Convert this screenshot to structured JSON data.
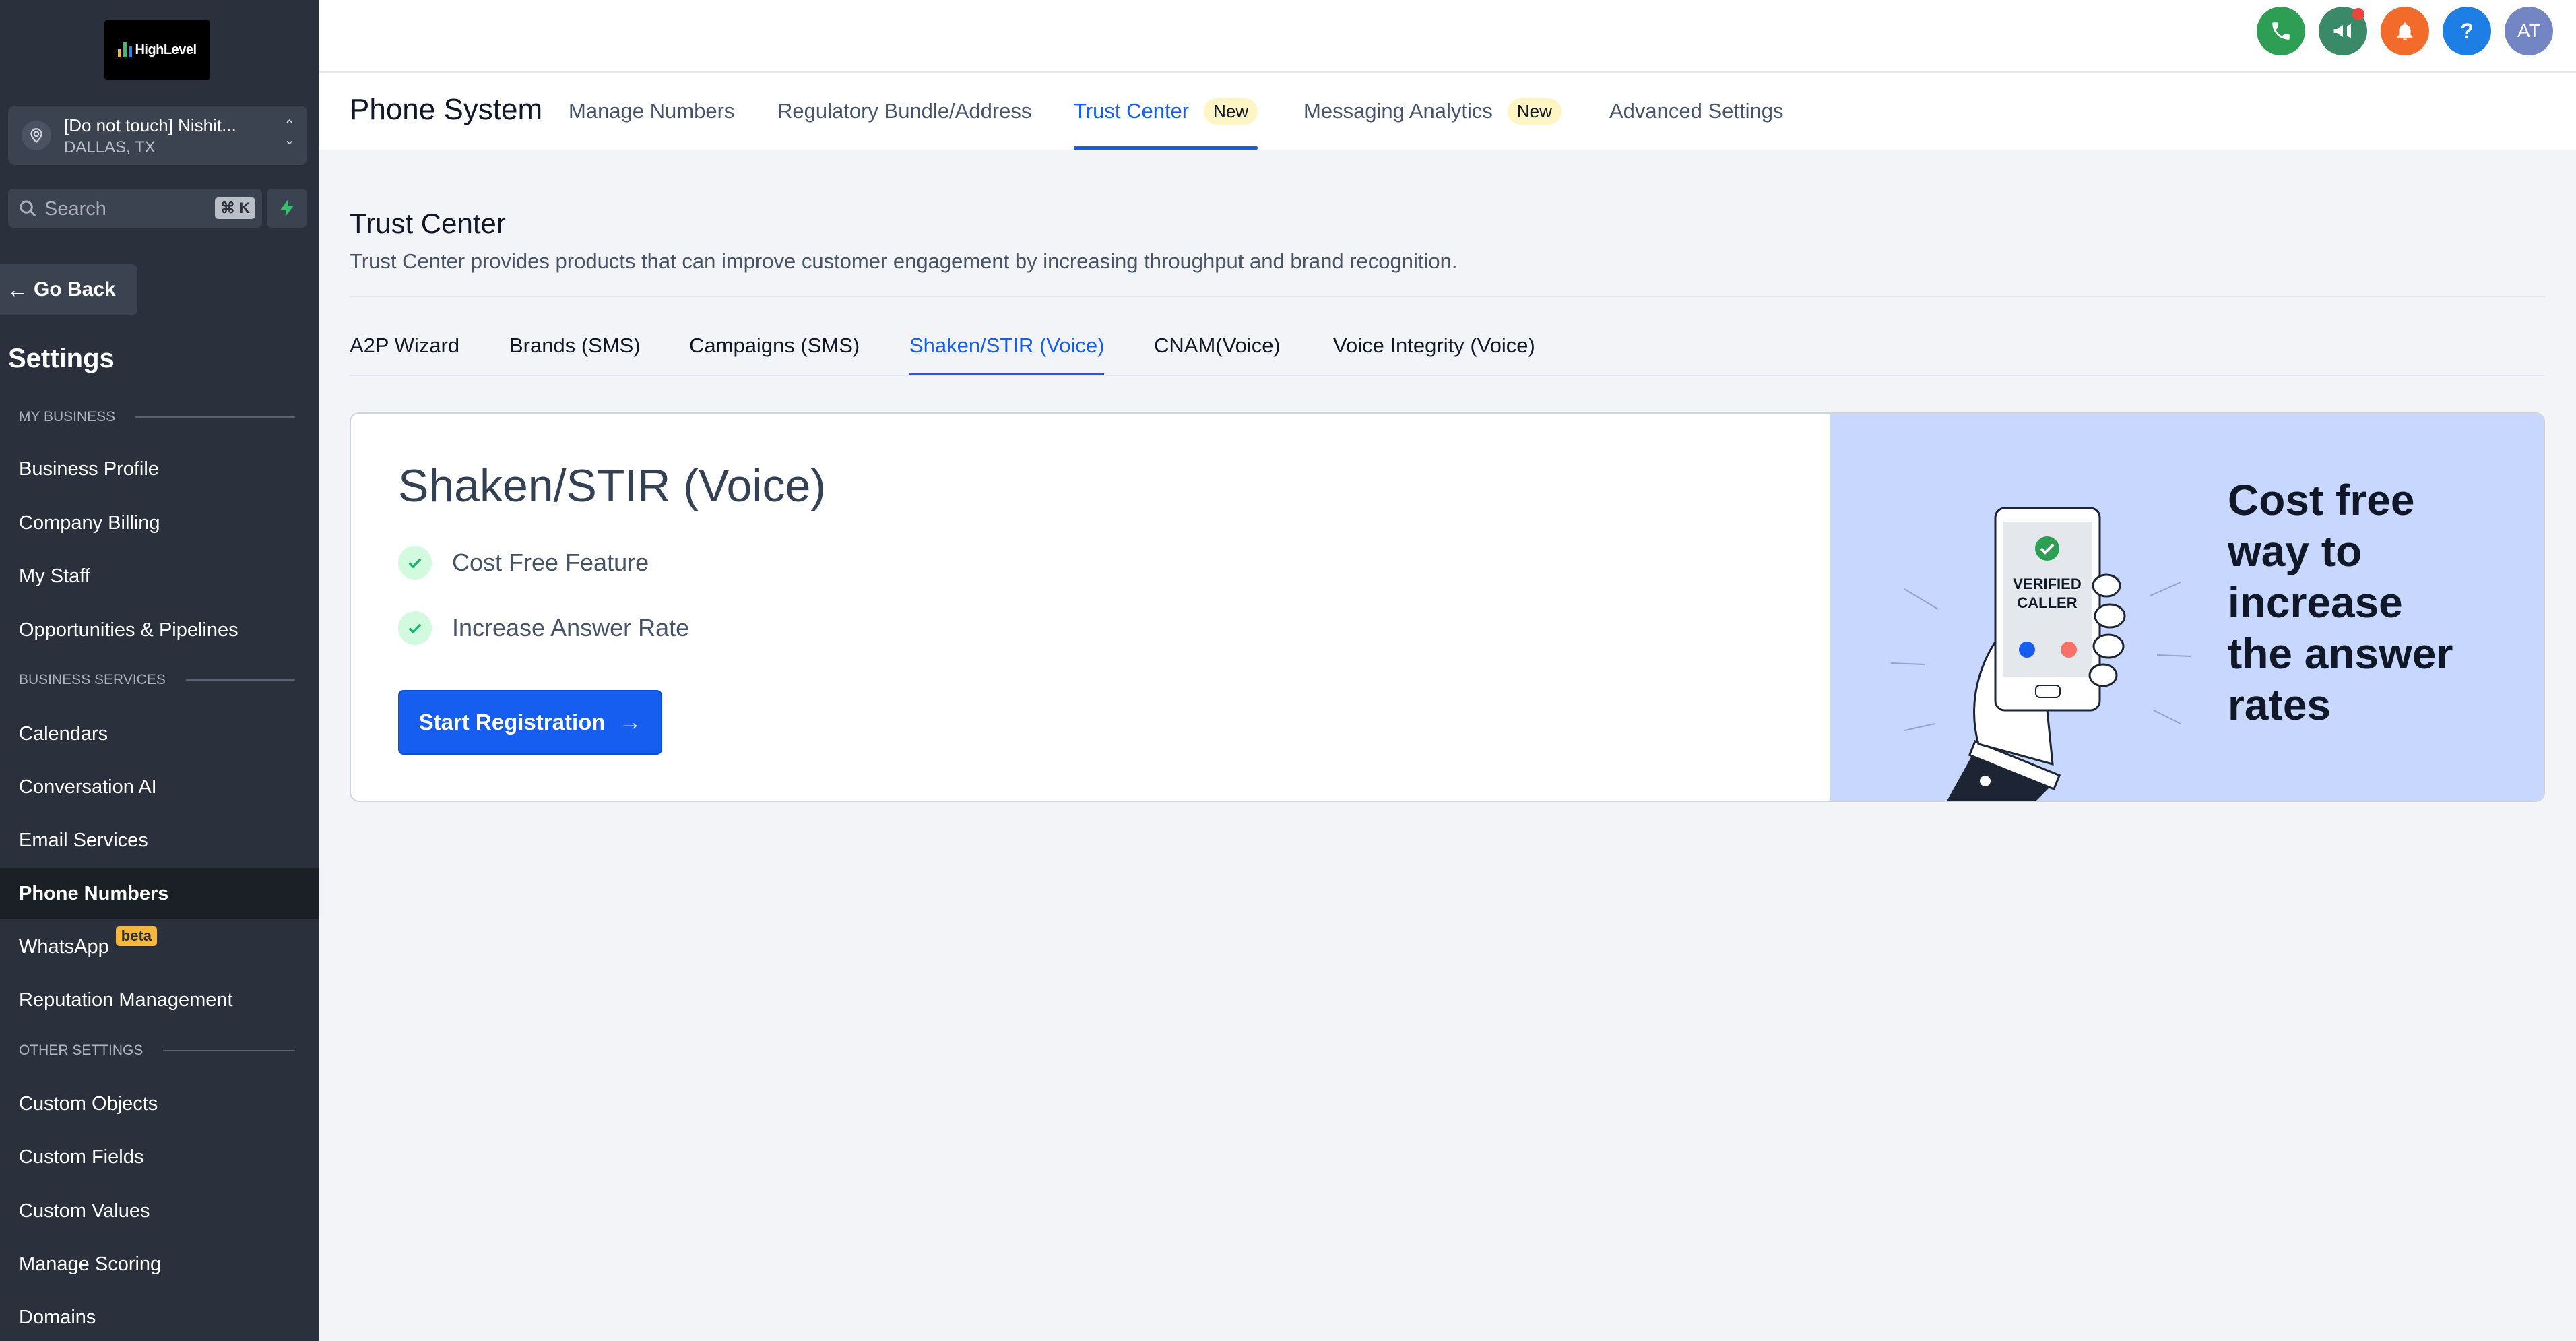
{
  "brand": {
    "logo_text": "HighLevel"
  },
  "account": {
    "name": "[Do not touch] Nishit...",
    "location": "DALLAS, TX"
  },
  "search": {
    "placeholder": "Search",
    "shortcut": "⌘ K"
  },
  "sidebar": {
    "go_back": "Go Back",
    "settings_title": "Settings",
    "sections": {
      "my_business": "MY BUSINESS",
      "business_services": "BUSINESS SERVICES",
      "other_settings": "OTHER SETTINGS"
    },
    "items": {
      "business_profile": "Business Profile",
      "company_billing": "Company Billing",
      "my_staff": "My Staff",
      "opportunities": "Opportunities & Pipelines",
      "calendars": "Calendars",
      "conversation_ai": "Conversation AI",
      "email_services": "Email Services",
      "phone_numbers": "Phone Numbers",
      "whatsapp": "WhatsApp",
      "whatsapp_badge": "beta",
      "reputation": "Reputation Management",
      "custom_objects": "Custom Objects",
      "custom_fields": "Custom Fields",
      "custom_values": "Custom Values",
      "manage_scoring": "Manage Scoring",
      "domains": "Domains"
    }
  },
  "topbar": {
    "avatar_initials": "AT",
    "help_glyph": "?",
    "colors": {
      "phone": "#2e9e55",
      "announce": "#3a8a6a",
      "bell": "#f26b2a",
      "help": "#1d7fe6",
      "avatar": "#7485c4"
    }
  },
  "subnav": {
    "title": "Phone System",
    "tabs": {
      "manage_numbers": "Manage Numbers",
      "regulatory": "Regulatory Bundle/Address",
      "trust_center": "Trust Center",
      "trust_center_badge": "New",
      "messaging": "Messaging Analytics",
      "messaging_badge": "New",
      "advanced": "Advanced Settings"
    }
  },
  "trust_center": {
    "title": "Trust Center",
    "description": "Trust Center provides products that can improve customer engagement by increasing throughput and brand recognition.",
    "tabs": {
      "a2p": "A2P Wizard",
      "brands": "Brands (SMS)",
      "campaigns": "Campaigns (SMS)",
      "shaken": "Shaken/STIR (Voice)",
      "cnam": "CNAM(Voice)",
      "voice_integrity": "Voice Integrity (Voice)"
    }
  },
  "card": {
    "title": "Shaken/STIR (Voice)",
    "features": [
      "Cost Free Feature",
      "Increase Answer Rate"
    ],
    "button": "Start Registration",
    "promo_lines": [
      "Cost free",
      "way to",
      "increase",
      "the answer",
      "rates"
    ],
    "phone_screen": [
      "VERIFIED",
      "CALLER"
    ],
    "accent": "#155eef"
  }
}
